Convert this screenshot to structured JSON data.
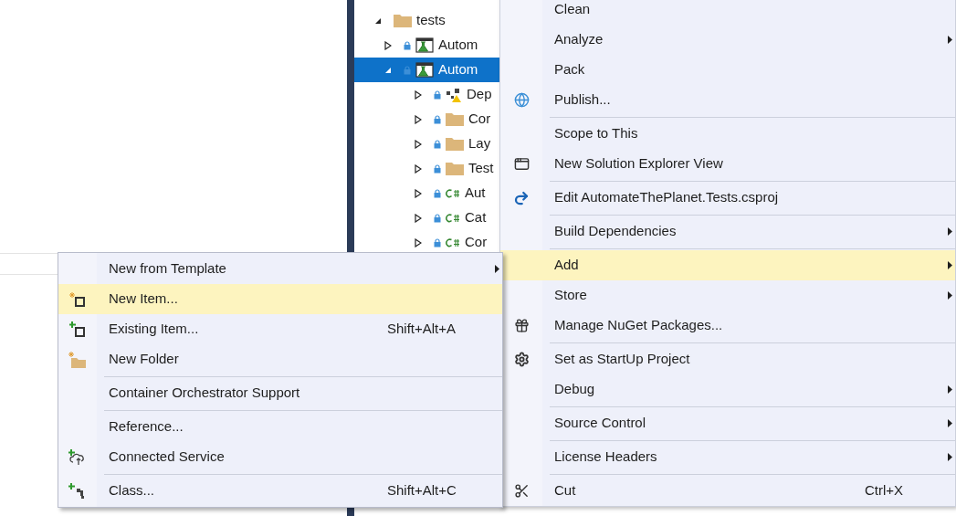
{
  "solution_explorer": {
    "tree": [
      {
        "label": "tests",
        "kind": "folder",
        "expanded": true,
        "selected": false,
        "children": [
          {
            "label": "Autom",
            "kind": "test_project",
            "expanded": false,
            "selected": false
          },
          {
            "label": "Autom",
            "kind": "test_project",
            "expanded": true,
            "selected": true,
            "children": [
              {
                "label": "Dep",
                "kind": "dependencies",
                "expanded": false,
                "selected": false
              },
              {
                "label": "Cor",
                "kind": "folder",
                "expanded": false,
                "selected": false
              },
              {
                "label": "Lay",
                "kind": "folder",
                "expanded": false,
                "selected": false
              },
              {
                "label": "Test",
                "kind": "folder",
                "expanded": false,
                "selected": false
              },
              {
                "label": "Aut",
                "kind": "csharp",
                "expanded": false,
                "selected": false
              },
              {
                "label": "Cat",
                "kind": "csharp",
                "expanded": false,
                "selected": false
              },
              {
                "label": "Cor",
                "kind": "csharp",
                "expanded": false,
                "selected": false
              }
            ]
          }
        ]
      }
    ]
  },
  "context_menu": {
    "items": [
      {
        "kind": "item",
        "label": "Clean",
        "has_submenu": false,
        "selected": false
      },
      {
        "kind": "item",
        "label": "Analyze",
        "has_submenu": true,
        "selected": false
      },
      {
        "kind": "item",
        "label": "Pack",
        "has_submenu": false,
        "selected": false
      },
      {
        "kind": "item",
        "label": "Publish...",
        "has_submenu": false,
        "selected": false
      },
      {
        "kind": "separator"
      },
      {
        "kind": "item",
        "label": "Scope to This",
        "has_submenu": false,
        "selected": false
      },
      {
        "kind": "item",
        "label": "New Solution Explorer View",
        "has_submenu": false,
        "selected": false
      },
      {
        "kind": "separator"
      },
      {
        "kind": "item",
        "label": "Edit AutomateThePlanet.Tests.csproj",
        "has_submenu": false,
        "selected": false
      },
      {
        "kind": "separator"
      },
      {
        "kind": "item",
        "label": "Build Dependencies",
        "has_submenu": true,
        "selected": false
      },
      {
        "kind": "separator"
      },
      {
        "kind": "item",
        "label": "Add",
        "has_submenu": true,
        "selected": true
      },
      {
        "kind": "item",
        "label": "Store",
        "has_submenu": true,
        "selected": false
      },
      {
        "kind": "item",
        "label": "Manage NuGet Packages...",
        "has_submenu": false,
        "selected": false
      },
      {
        "kind": "separator"
      },
      {
        "kind": "item",
        "label": "Set as StartUp Project",
        "has_submenu": false,
        "selected": false
      },
      {
        "kind": "item",
        "label": "Debug",
        "has_submenu": true,
        "selected": false
      },
      {
        "kind": "separator"
      },
      {
        "kind": "item",
        "label": "Source Control",
        "has_submenu": true,
        "selected": false
      },
      {
        "kind": "separator"
      },
      {
        "kind": "item",
        "label": "License Headers",
        "has_submenu": true,
        "selected": false
      },
      {
        "kind": "separator"
      },
      {
        "kind": "item",
        "label": "Cut",
        "shortcut": "Ctrl+X",
        "has_submenu": false,
        "selected": false
      }
    ]
  },
  "add_submenu": {
    "items": [
      {
        "kind": "item",
        "label": "New from Template",
        "has_submenu": true,
        "selected": false
      },
      {
        "kind": "item",
        "label": "New Item...",
        "has_submenu": false,
        "selected": true
      },
      {
        "kind": "item",
        "label": "Existing Item...",
        "shortcut": "Shift+Alt+A",
        "has_submenu": false,
        "selected": false
      },
      {
        "kind": "item",
        "label": "New Folder",
        "has_submenu": false,
        "selected": false
      },
      {
        "kind": "separator"
      },
      {
        "kind": "item",
        "label": "Container Orchestrator Support",
        "has_submenu": false,
        "selected": false
      },
      {
        "kind": "separator"
      },
      {
        "kind": "item",
        "label": "Reference...",
        "has_submenu": false,
        "selected": false
      },
      {
        "kind": "item",
        "label": "Connected Service",
        "has_submenu": false,
        "selected": false
      },
      {
        "kind": "separator"
      },
      {
        "kind": "item",
        "label": "Class...",
        "shortcut": "Shift+Alt+C",
        "has_submenu": false,
        "selected": false
      }
    ]
  }
}
